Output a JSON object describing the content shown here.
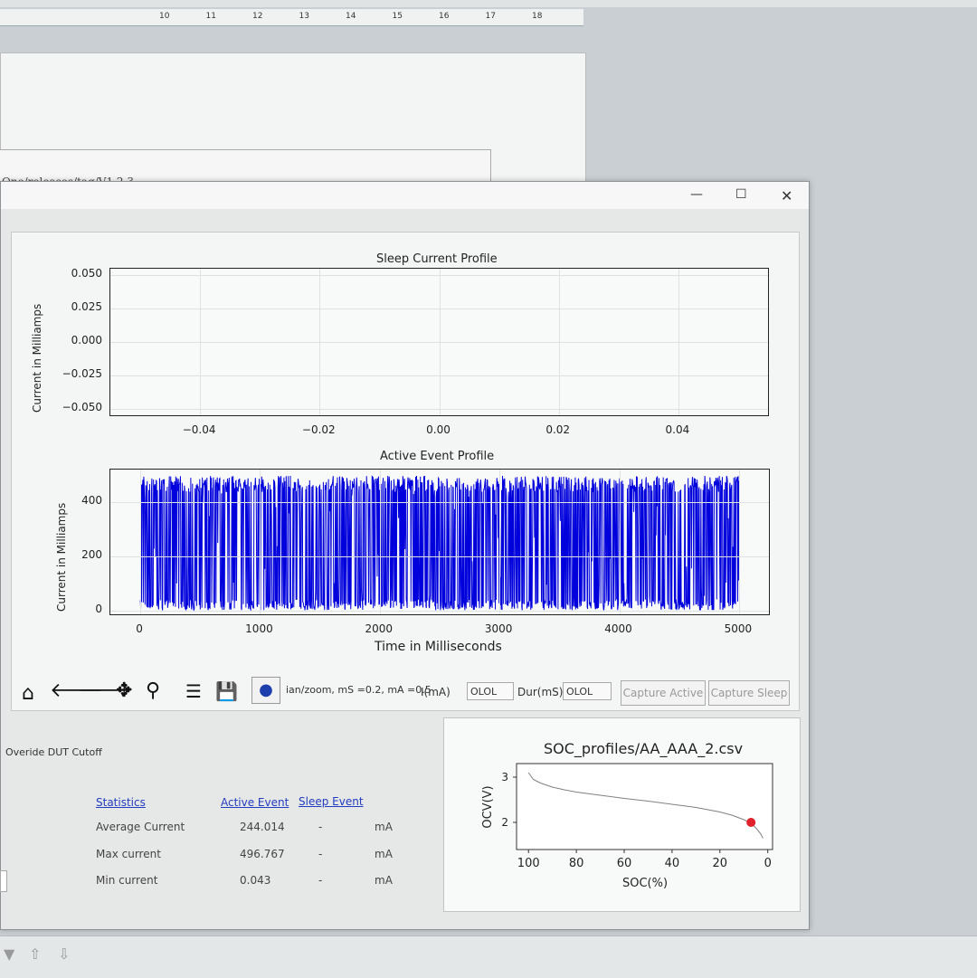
{
  "background": {
    "ruler_numbers": [
      "10",
      "11",
      "12",
      "13",
      "14",
      "15",
      "16",
      "17",
      "18"
    ],
    "doc_path": "One/releases/tag/V1.2.3"
  },
  "window": {
    "minimize_icon": "minimize-icon",
    "maximize_icon": "maximize-icon",
    "close_icon": "close-icon"
  },
  "toolbar": {
    "status_text": "ian/zoom, mS =0.2, mA =0.5",
    "current_label": "I(mA)",
    "current_value": "OLOL",
    "duration_label": "Dur(mS)",
    "duration_value": "OLOL",
    "capture_active_label": "Capture Active",
    "capture_sleep_label": "Capture Sleep"
  },
  "override_label": "Overide DUT Cutoff",
  "statistics": {
    "header_label": "Statistics",
    "active_header": "Active Event",
    "sleep_header": "Sleep Event",
    "rows": [
      {
        "label": "Average Current",
        "active": "244.014",
        "sleep": "-",
        "unit": "mA"
      },
      {
        "label": "Max current",
        "active": "496.767",
        "sleep": "-",
        "unit": "mA"
      },
      {
        "label": "Min current",
        "active": "0.043",
        "sleep": "-",
        "unit": "mA"
      }
    ]
  },
  "chart_data": [
    {
      "type": "line",
      "title": "Sleep Current Profile",
      "ylabel": "Current in Milliamps",
      "xlabel": "",
      "xlim": [
        -0.055,
        0.055
      ],
      "ylim": [
        -0.055,
        0.055
      ],
      "x_ticks": [
        "−0.04",
        "−0.02",
        "0.00",
        "0.02",
        "0.04"
      ],
      "x_tick_values": [
        -0.04,
        -0.02,
        0.0,
        0.02,
        0.04
      ],
      "y_ticks": [
        "0.050",
        "0.025",
        "0.000",
        "−0.025",
        "−0.050"
      ],
      "y_tick_values": [
        0.05,
        0.025,
        0.0,
        -0.025,
        -0.05
      ],
      "grid": true,
      "series": []
    },
    {
      "type": "line",
      "title": "Active Event Profile",
      "ylabel": "Current in Milliamps",
      "xlabel": "Time in Milliseconds",
      "xlim": [
        -250,
        5250
      ],
      "ylim": [
        -15,
        520
      ],
      "x_ticks": [
        "0",
        "1000",
        "2000",
        "3000",
        "4000",
        "5000"
      ],
      "x_tick_values": [
        0,
        1000,
        2000,
        3000,
        4000,
        5000
      ],
      "y_ticks": [
        "400",
        "200",
        "0"
      ],
      "y_tick_values": [
        400,
        200,
        0
      ],
      "grid": true,
      "series": [
        {
          "color": "#0000dd",
          "x_range": [
            0,
            5000
          ],
          "min": 0.043,
          "max": 496.767,
          "mean": 244.014
        }
      ]
    },
    {
      "type": "line",
      "title": "SOC_profiles/AA_AAA_2.csv",
      "xlabel": "SOC(%)",
      "ylabel": "OCV(V)",
      "xlim": [
        105,
        -2
      ],
      "ylim": [
        1.4,
        3.3
      ],
      "x_ticks": [
        "100",
        "80",
        "60",
        "40",
        "20",
        "0"
      ],
      "x_tick_values": [
        100,
        80,
        60,
        40,
        20,
        0
      ],
      "y_ticks": [
        "3",
        "2"
      ],
      "y_tick_values": [
        3,
        2
      ],
      "series": [
        {
          "color": "#808080",
          "x": [
            100,
            98,
            95,
            90,
            85,
            80,
            70,
            60,
            50,
            40,
            30,
            20,
            15,
            10,
            7,
            5,
            3,
            2
          ],
          "y": [
            3.1,
            2.95,
            2.87,
            2.78,
            2.72,
            2.67,
            2.6,
            2.53,
            2.47,
            2.4,
            2.33,
            2.23,
            2.16,
            2.06,
            1.98,
            1.88,
            1.75,
            1.65
          ]
        }
      ],
      "marker": {
        "x": 7,
        "y": 2.0,
        "color": "#e0202a"
      }
    }
  ]
}
